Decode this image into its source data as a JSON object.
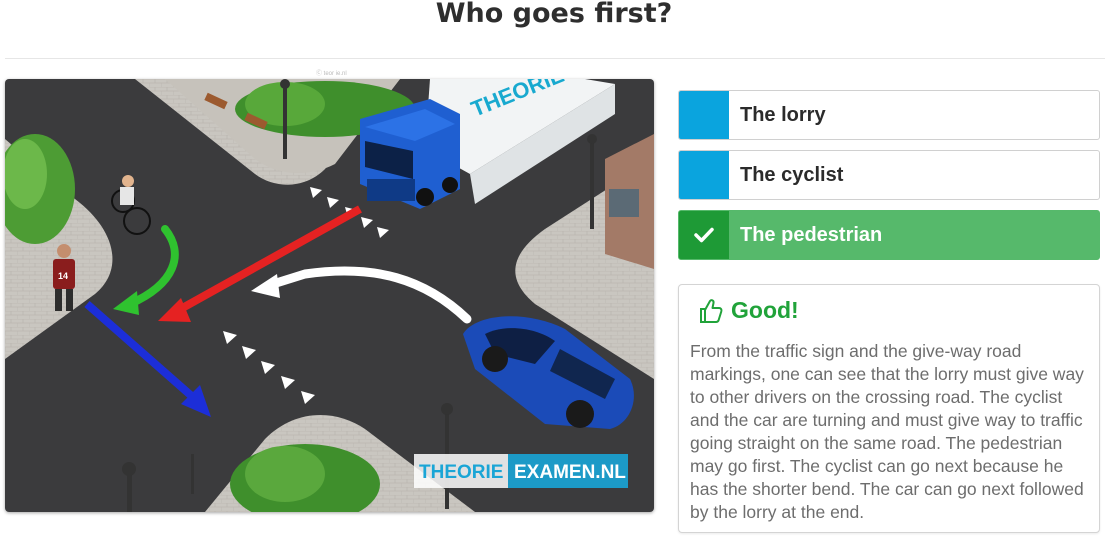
{
  "page": {
    "title": "Who goes first?"
  },
  "image": {
    "copyright": "Ⓒ teor ie.nl",
    "truck_brand": "THEORIE",
    "pedestrian_number": "14",
    "watermark_left": "THEORIE",
    "watermark_right": "EXAMEN.NL",
    "arrow_colors": {
      "green": "#2fc22f",
      "red": "#e52222",
      "blue": "#1c2ed8",
      "white": "#ffffff"
    }
  },
  "answers": [
    {
      "label": "The lorry",
      "state": "neutral"
    },
    {
      "label": "The cyclist",
      "state": "neutral"
    },
    {
      "label": "The pedestrian",
      "state": "correct",
      "icon": "check-icon"
    }
  ],
  "feedback": {
    "icon": "thumbs-up-icon",
    "title": "Good!",
    "text": "From the traffic sign and the give-way road markings, one can see that the lorry must give way to other drivers on the crossing road. The cyclist and the car are turning and must give way to traffic going straight on the same road. The pedestrian may go first. The cyclist can go next because he has the shorter bend. The car can go next followed by the lorry at the end."
  },
  "colors": {
    "accent_blue": "#0aa4de",
    "correct_green": "#56b96b",
    "correct_dark": "#1e9a36",
    "feedback_green": "#21a33a"
  }
}
